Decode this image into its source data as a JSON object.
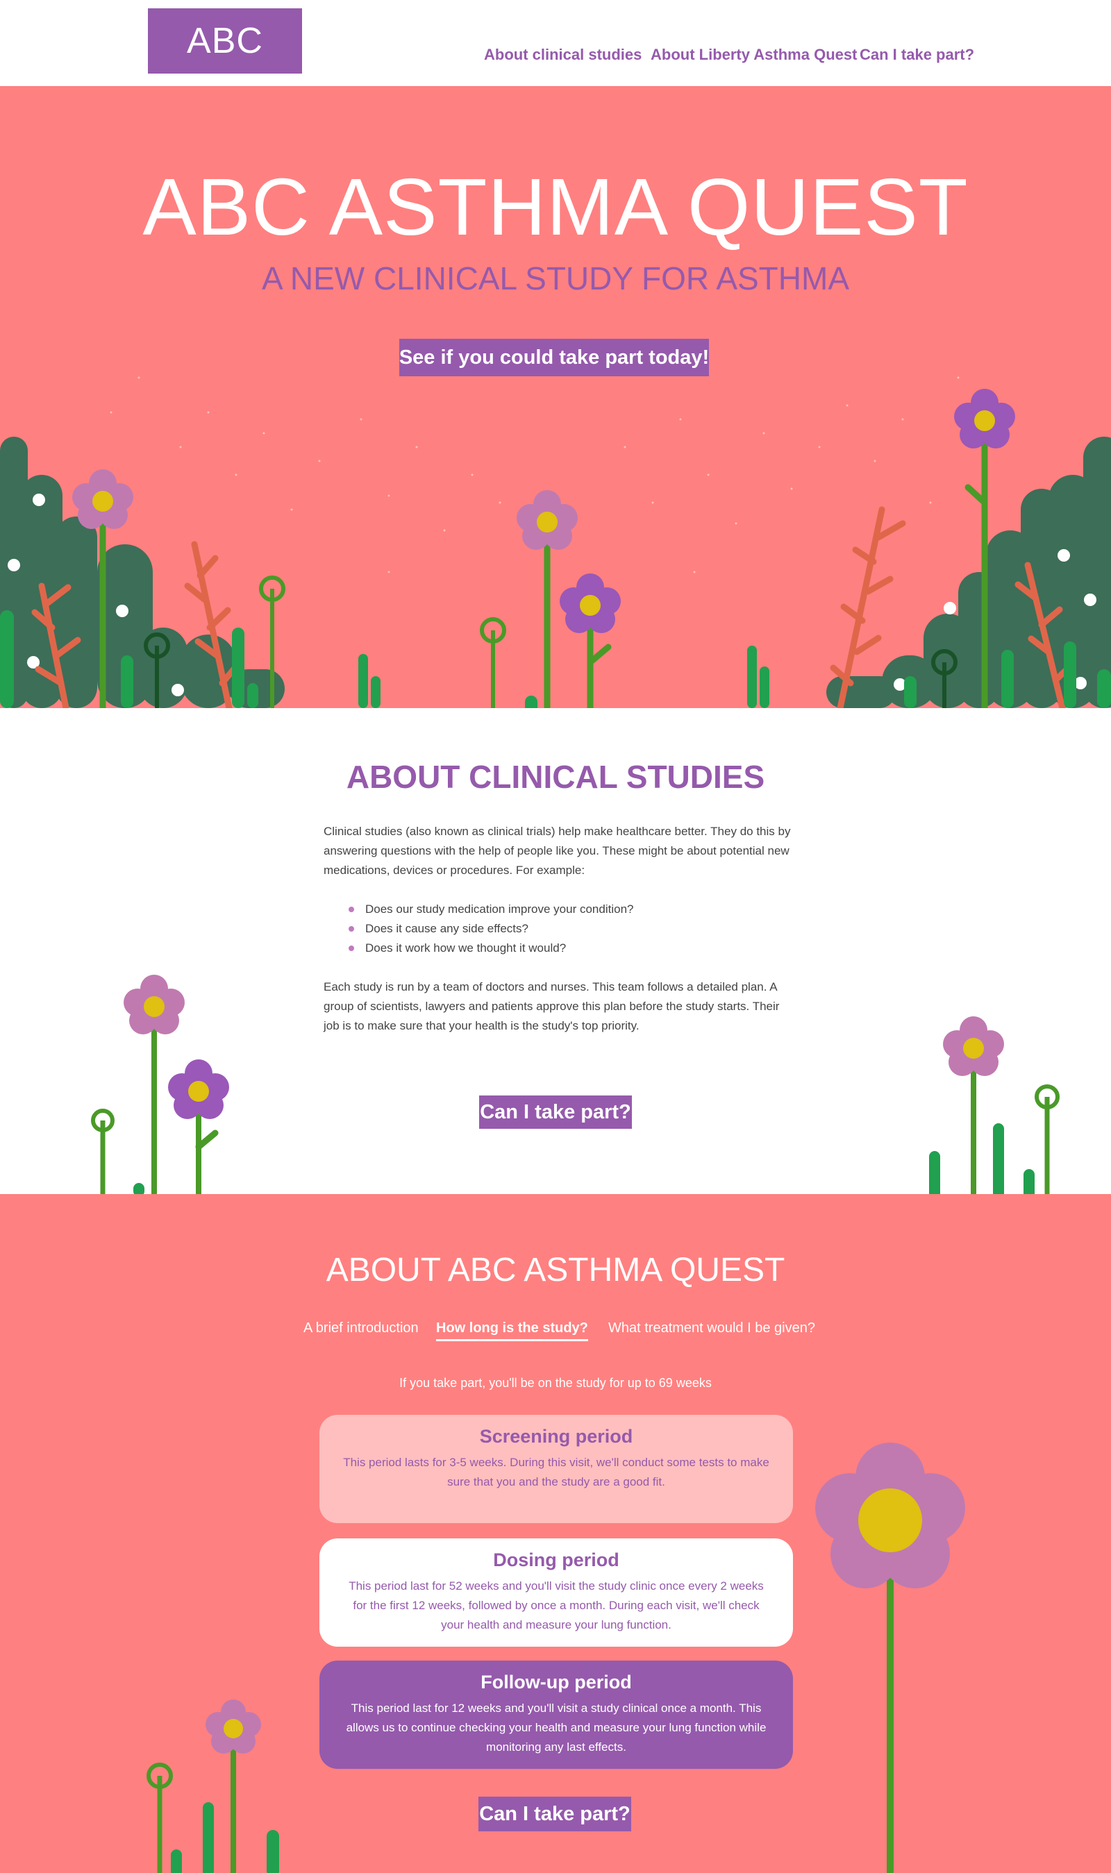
{
  "header": {
    "logo": "ABC",
    "nav": [
      {
        "label": "About clinical studies"
      },
      {
        "label": "About Liberty Asthma Quest"
      },
      {
        "label": "Can I take part?"
      }
    ]
  },
  "hero": {
    "title": "ABC ASTHMA QUEST",
    "subtitle": "A NEW CLINICAL STUDY FOR ASTHMA",
    "cta": "See if you could take part today!"
  },
  "about": {
    "heading": "ABOUT CLINICAL STUDIES",
    "intro": "Clinical studies (also known as clinical trials) help make healthcare better. They do this by answering questions with the help of people like you. These might be about potential new medications, devices or procedures. For example:",
    "bullets": [
      "Does our study medication improve your condition?",
      "Does it cause any side effects?",
      "Does it work how we thought it would?"
    ],
    "outro": "Each study is run by a team of doctors and nurses. This team follows a detailed plan. A group of scientists, lawyers and patients approve this plan before the study starts. Their job is to make sure that your health is the study's top priority.",
    "cta": "Can I take part?"
  },
  "quest": {
    "heading": "ABOUT ABC ASTHMA QUEST",
    "tabs": [
      {
        "label": "A brief introduction",
        "active": false
      },
      {
        "label": "How long is the study?",
        "active": true
      },
      {
        "label": "What treatment would I be given?",
        "active": false
      }
    ],
    "duration": "If you take part, you'll be on the study for up to 69 weeks",
    "periods": [
      {
        "title": "Screening period",
        "text": "This period lasts for 3-5 weeks. During this visit, we'll conduct some tests to make sure that you and the study are a good fit."
      },
      {
        "title": "Dosing period",
        "text": "This period last for 52 weeks and you'll visit the study clinic once every 2 weeks for the first 12 weeks, followed by once a month.  During each visit, we'll check your health and measure your lung function."
      },
      {
        "title": "Follow-up period",
        "text": "This period last for 12 weeks and you'll visit a study clinical once a month.  This allows us to continue checking your health and measure your lung function while monitoring any last effects."
      }
    ],
    "cta": "Can I take part?"
  },
  "colors": {
    "purple": "#955aac",
    "coral": "#ff8080",
    "pink_card": "#ffbfbf",
    "flower_pink": "#c07ab0",
    "flower_center": "#e0c010",
    "stem_green": "#4a9a28",
    "bush_green": "#3d6e58",
    "bright_green": "#21a050",
    "fern": "#e0664a"
  }
}
